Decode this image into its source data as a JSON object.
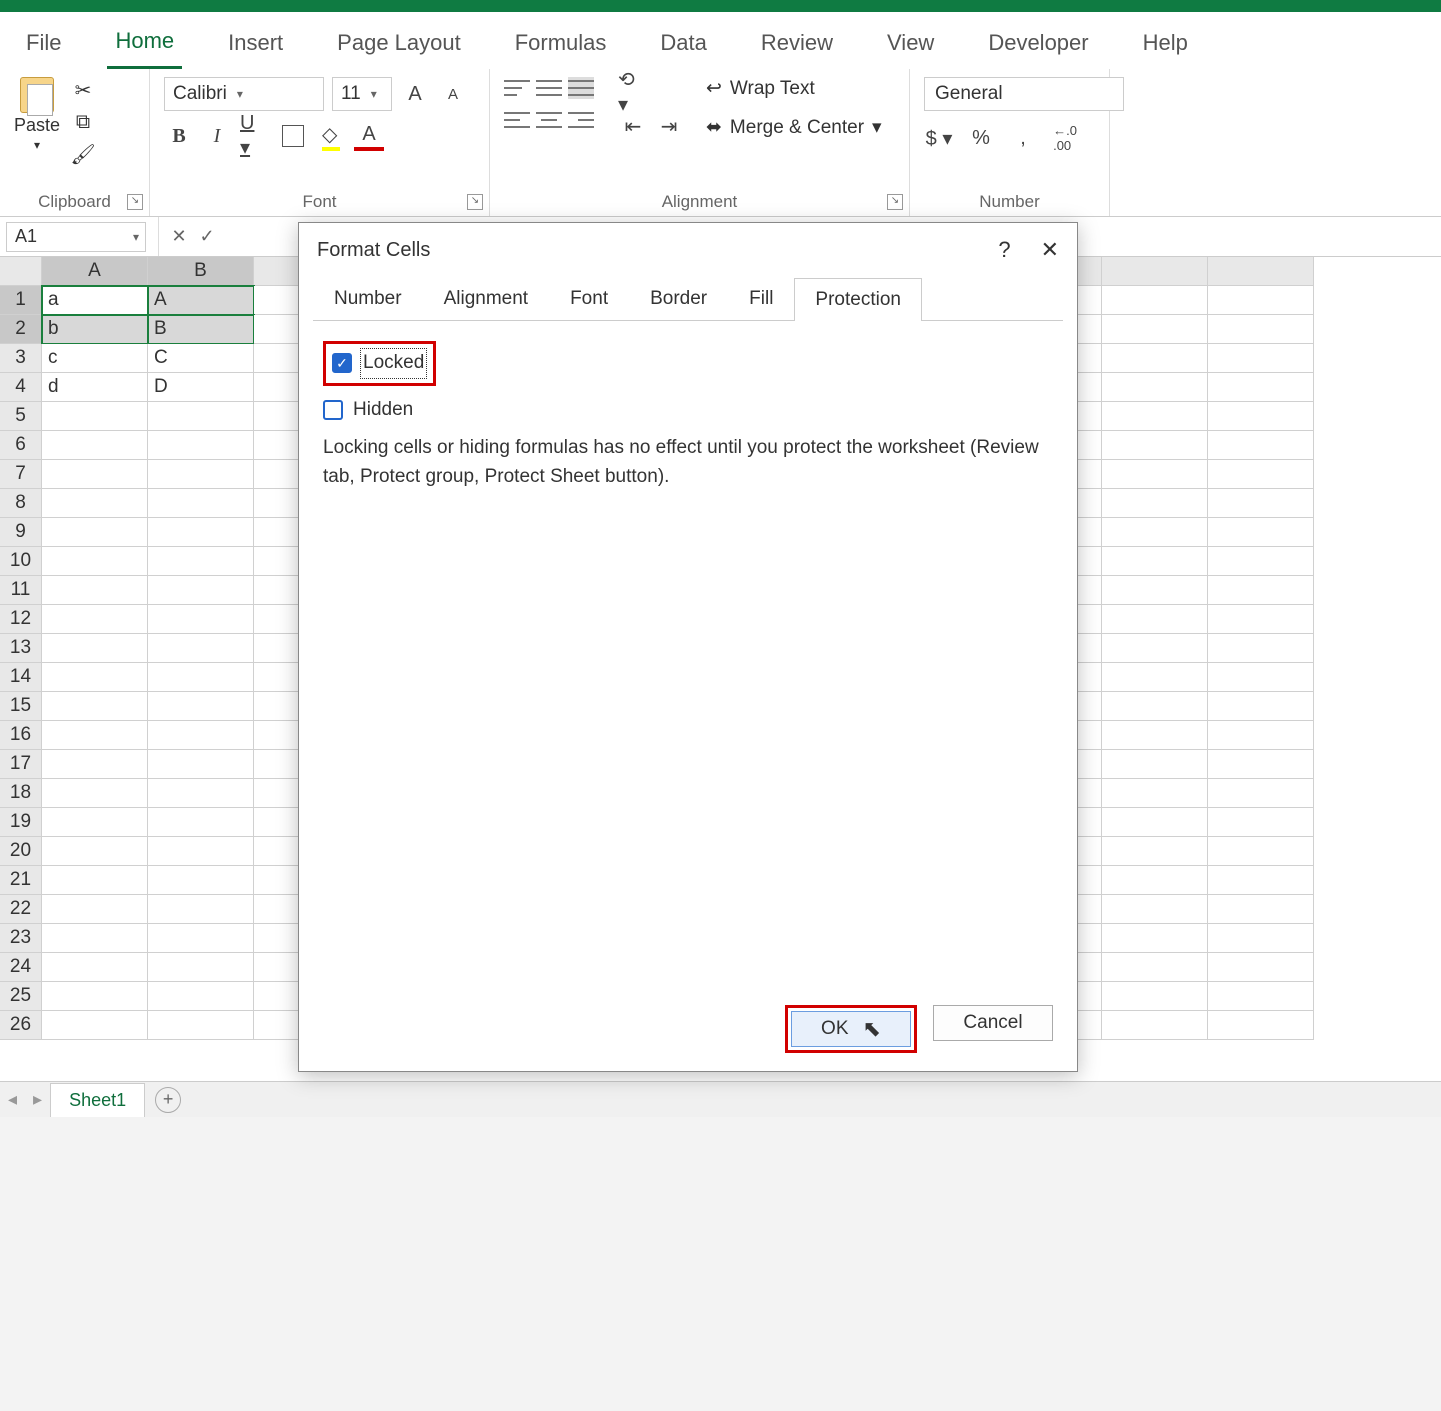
{
  "tabs": {
    "file": "File",
    "home": "Home",
    "insert": "Insert",
    "pagelayout": "Page Layout",
    "formulas": "Formulas",
    "data": "Data",
    "review": "Review",
    "view": "View",
    "developer": "Developer",
    "help": "Help"
  },
  "ribbon": {
    "clipboard": {
      "paste": "Paste",
      "label": "Clipboard"
    },
    "font": {
      "name": "Calibri",
      "size": "11",
      "label": "Font"
    },
    "alignment": {
      "wrap": "Wrap Text",
      "merge": "Merge & Center",
      "label": "Alignment"
    },
    "number": {
      "format": "General",
      "label": "Number"
    }
  },
  "namebox": "A1",
  "columns": [
    "A",
    "B"
  ],
  "rows": [
    "1",
    "2",
    "3",
    "4",
    "5",
    "6",
    "7",
    "8",
    "9",
    "10",
    "11",
    "12",
    "13",
    "14",
    "15",
    "16",
    "17",
    "18",
    "19",
    "20",
    "21",
    "22",
    "23",
    "24",
    "25",
    "26"
  ],
  "cells": {
    "A1": "a",
    "B1": "A",
    "A2": "b",
    "B2": "B",
    "A3": "c",
    "B3": "C",
    "A4": "d",
    "B4": "D"
  },
  "sheettab": "Sheet1",
  "dialog": {
    "title": "Format Cells",
    "help": "?",
    "close": "✕",
    "tabs": {
      "number": "Number",
      "alignment": "Alignment",
      "font": "Font",
      "border": "Border",
      "fill": "Fill",
      "protection": "Protection"
    },
    "locked": "Locked",
    "hidden": "Hidden",
    "description": "Locking cells or hiding formulas has no effect until you protect the worksheet (Review tab, Protect group, Protect Sheet button).",
    "ok": "OK",
    "cancel": "Cancel"
  }
}
